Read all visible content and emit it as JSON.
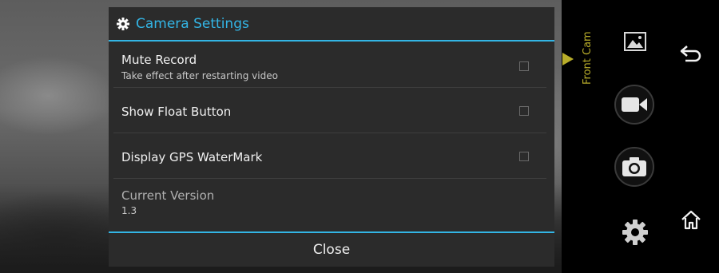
{
  "dialog": {
    "title": "Camera Settings",
    "title_icon": "gear-icon",
    "accent_color": "#33b5e5",
    "settings": {
      "mute_record": {
        "title": "Mute Record",
        "summary": "Take effect after restarting video",
        "checked": false
      },
      "show_float_button": {
        "title": "Show Float Button",
        "checked": false
      },
      "display_gps_watermark": {
        "title": "Display GPS WaterMark",
        "checked": false
      },
      "current_version": {
        "title": "Current Version",
        "value": "1.3"
      }
    },
    "close_label": "Close"
  },
  "side_panel": {
    "camera_label": "Front Cam",
    "camera_label_color": "#b8ad2a",
    "gallery_icon": "gallery-icon",
    "video_icon": "video-camera-icon",
    "photo_icon": "photo-camera-icon",
    "settings_icon": "gear-icon",
    "back_icon": "back-arrow-icon",
    "home_icon": "home-icon"
  }
}
